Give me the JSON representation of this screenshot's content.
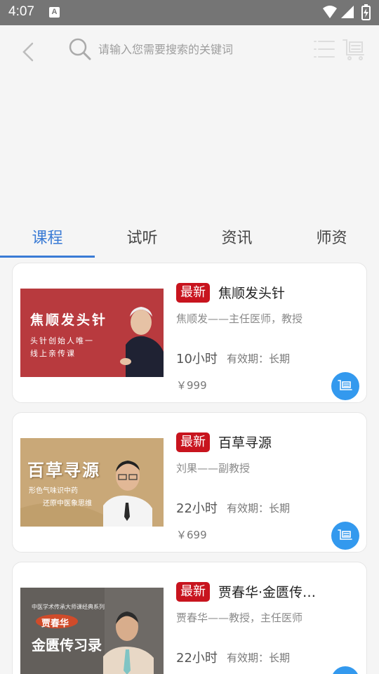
{
  "status_bar": {
    "time": "4:07",
    "notification_letter": "A"
  },
  "search": {
    "placeholder": "请输入您需要搜索的关键词"
  },
  "tabs": [
    {
      "label": "课程",
      "active": true
    },
    {
      "label": "试听",
      "active": false
    },
    {
      "label": "资讯",
      "active": false
    },
    {
      "label": "师资",
      "active": false
    }
  ],
  "courses": [
    {
      "badge": "最新",
      "title": "焦顺发头针",
      "teacher": "焦顺发——主任医师，教授",
      "hours": "10小时",
      "validity": "有效期：长期",
      "price": "￥999",
      "thumb": {
        "title": "焦顺发头针",
        "line1": "头针创始人唯一",
        "line2": "线上亲传课",
        "bg": "#b83a3e"
      }
    },
    {
      "badge": "最新",
      "title": "百草寻源",
      "teacher": "刘果——副教授",
      "hours": "22小时",
      "validity": "有效期：长期",
      "price": "￥699",
      "thumb": {
        "title": "百草寻源",
        "line1": "形色气味识中药",
        "line2": "还原中医象思维",
        "bg": "#c9a878"
      }
    },
    {
      "badge": "最新",
      "title": "贾春华·金匮传习录",
      "teacher": "贾春华——教授，主任医师",
      "hours": "22小时",
      "validity": "有效期：长期",
      "price": "",
      "thumb": {
        "small": "中医学术传承大师课经典系列",
        "name": "贾春华",
        "title": "金匮传习录",
        "bg": "#6e6a66"
      }
    }
  ],
  "colors": {
    "accent": "#3a7bd5",
    "badge": "#c8141e",
    "cart": "#3399ee"
  }
}
